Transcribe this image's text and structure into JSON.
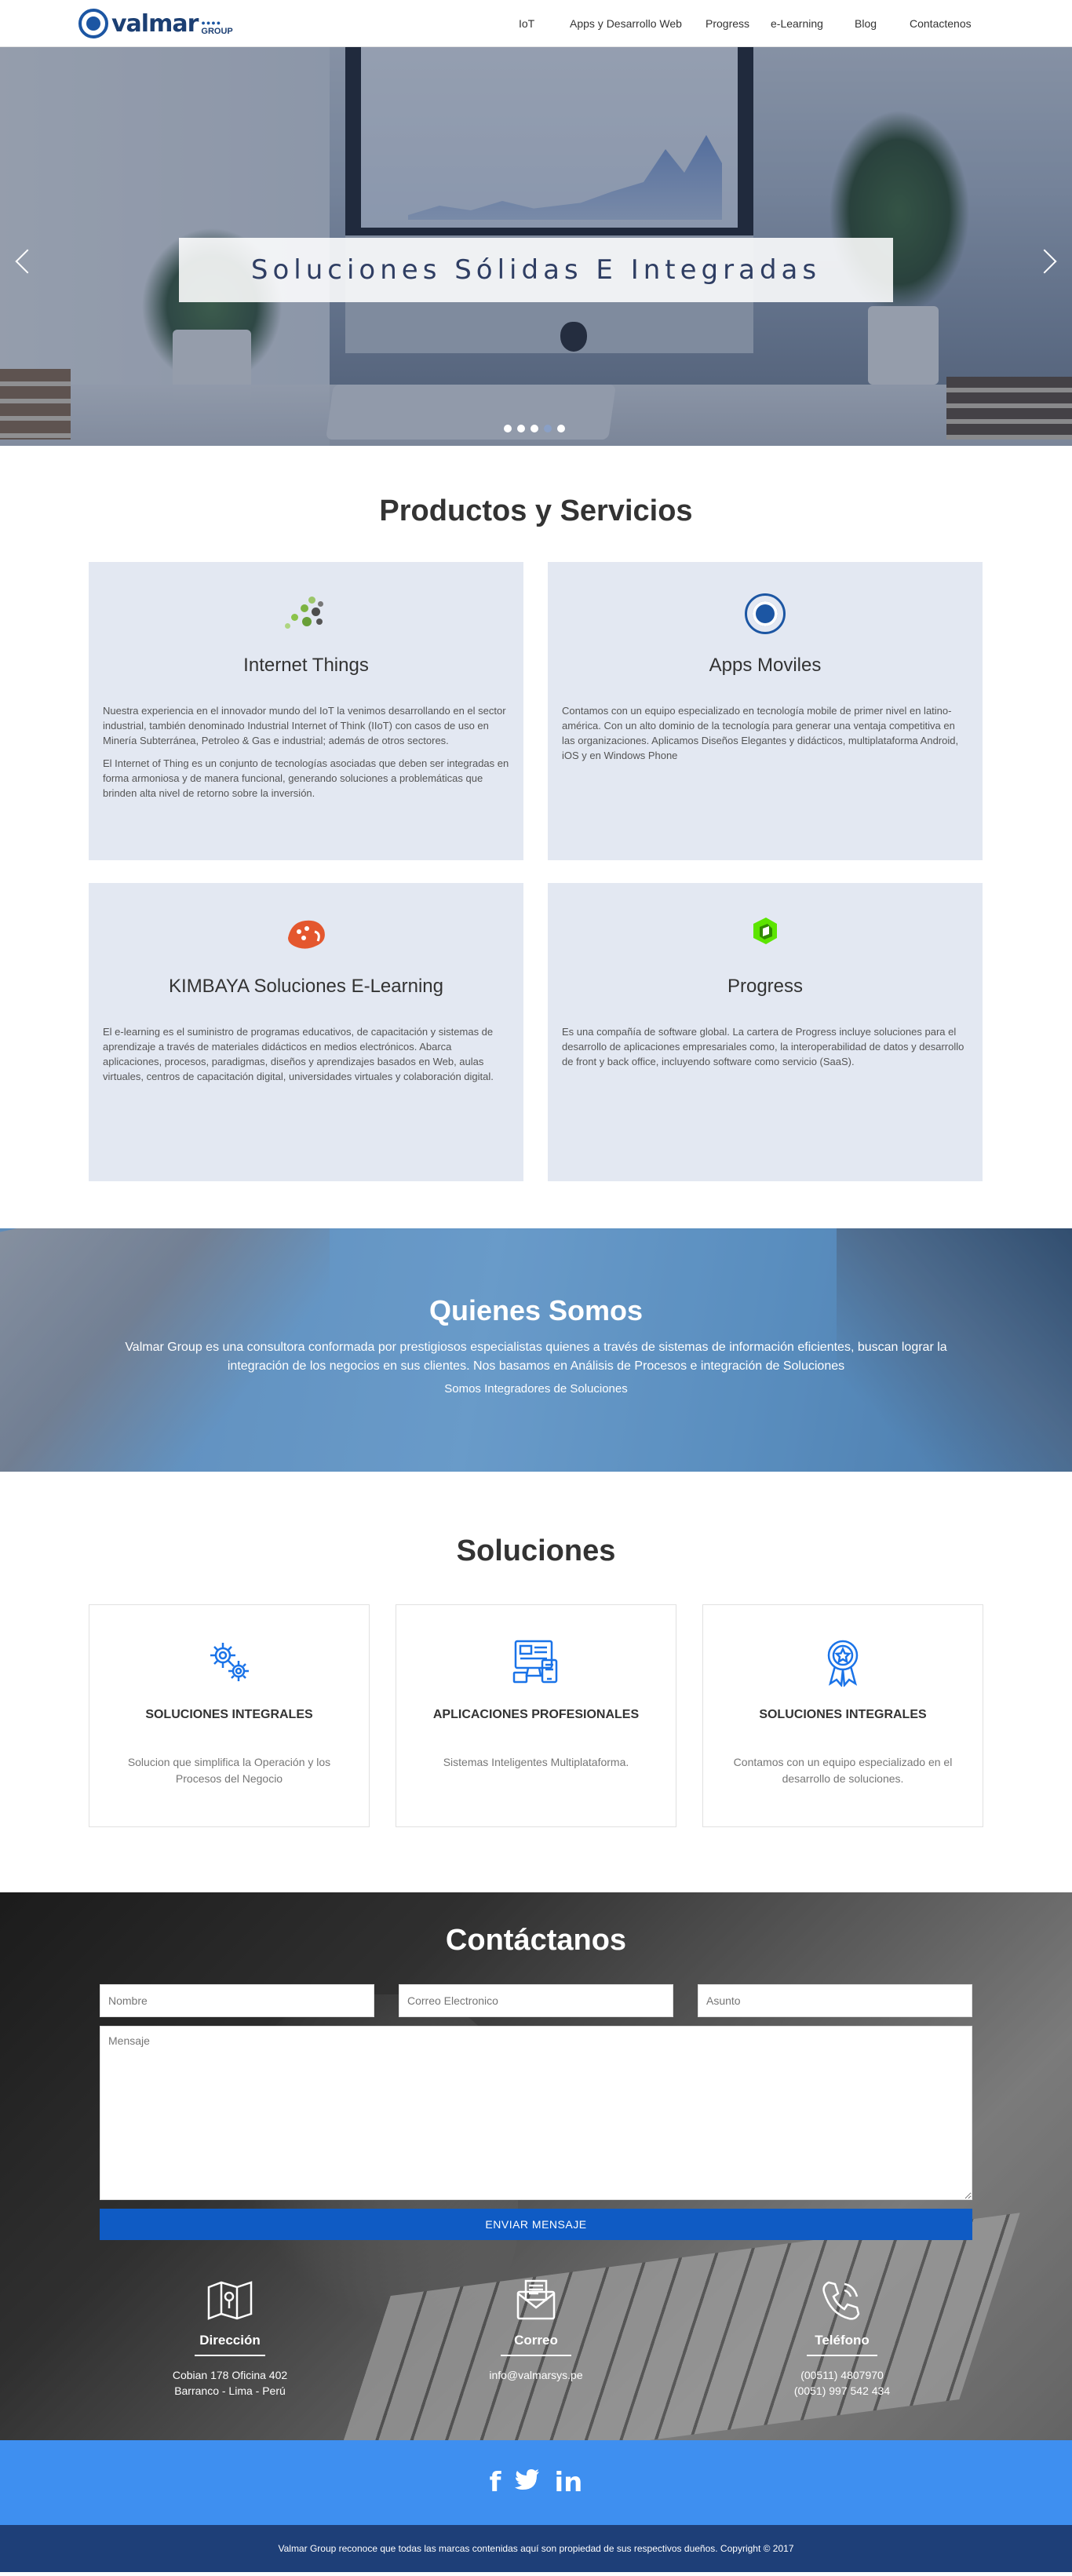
{
  "brand": {
    "name": "valmar",
    "group_text": "GROUP",
    "dots": "●●●●",
    "colors": {
      "primary": "#1c56a3",
      "dark": "#1c3f73",
      "button": "#0f5bc4",
      "social": "#3e8ff0",
      "footer": "#1e3f78",
      "card": "#e3e8f2"
    }
  },
  "nav": {
    "items": [
      {
        "label": "IoT"
      },
      {
        "label": "Apps y Desarrollo Web"
      },
      {
        "label": "Progress"
      },
      {
        "label": "e-Learning"
      },
      {
        "label": "Blog"
      },
      {
        "label": "Contactenos"
      }
    ]
  },
  "hero": {
    "caption": "Soluciones Sólidas E Integradas",
    "prev_icon": "chevron-left-icon",
    "next_icon": "chevron-right-icon",
    "slide_count": 5,
    "active_slide": 4
  },
  "productos": {
    "title": "Productos y Servicios",
    "cards": [
      {
        "icon": "iot-dots-icon",
        "title": "Internet Things",
        "paragraphs": [
          "Nuestra experiencia en el innovador mundo del IoT la venimos desarrollando en el sector industrial, también denominado Industrial Internet of Think (IIoT) con casos de uso en Minería Subterránea, Petroleo & Gas e industrial; además de otros sectores.",
          "El Internet of Thing es un conjunto de tecnologías asociadas que deben ser integradas en forma armoniosa y de manera funcional, generando soluciones a problemáticas que brinden alta nivel de retorno sobre la inversión."
        ]
      },
      {
        "icon": "circle-logo-icon",
        "title": "Apps Moviles",
        "paragraphs": [
          "Contamos con un equipo especializado en tecnología mobile de primer nivel en latino-américa. Con un alto dominio de la tecnología para generar una ventaja competitiva en las organizaciones. Aplicamos Diseños Elegantes y didácticos, multiplataforma Android, iOS y en Windows Phone"
        ]
      },
      {
        "icon": "kimbaya-logo-icon",
        "title": "KIMBAYA Soluciones E-Learning",
        "paragraphs": [
          "El e-learning es el suministro de programas educativos, de capacitación y sistemas de aprendizaje a través de materiales didácticos en medios electrónicos. Abarca aplicaciones, procesos, paradigmas, diseños y aprendizajes basados en Web, aulas virtuales, centros de capacitación digital, universidades virtuales y colaboración digital."
        ]
      },
      {
        "icon": "progress-logo-icon",
        "title": "Progress",
        "paragraphs": [
          "Es una compañía de software global. La cartera de Progress incluye soluciones para el desarrollo de aplicaciones empresariales como, la interoperabilidad de datos y desarrollo de front y back office, incluyendo software como servicio (SaaS)."
        ]
      }
    ]
  },
  "quienes": {
    "title": "Quienes Somos",
    "text": "Valmar Group es una consultora conformada por prestigiosos especialistas quienes a través de sistemas de información eficientes, buscan lograr la integración de los negocios en sus clientes. Nos basamos en Análisis de Procesos e integración de Soluciones",
    "subtitle": "Somos Integradores de Soluciones"
  },
  "soluciones": {
    "title": "Soluciones",
    "cards": [
      {
        "icon": "gears-icon",
        "title": "SOLUCIONES INTEGRALES",
        "text": "Solucion que simplifica la Operación y los Procesos del Negocio"
      },
      {
        "icon": "devices-icon",
        "title": "APLICACIONES PROFESIONALES",
        "text": "Sistemas Inteligentes Multiplataforma."
      },
      {
        "icon": "award-icon",
        "title": "SOLUCIONES INTEGRALES",
        "text": "Contamos con un equipo especializado en el desarrollo de soluciones."
      }
    ]
  },
  "contacto": {
    "title": "Contáctanos",
    "fields": {
      "nombre_placeholder": "Nombre",
      "email_placeholder": "Correo Electronico",
      "asunto_placeholder": "Asunto",
      "mensaje_placeholder": "Mensaje"
    },
    "button": "ENVIAR MENSAJE",
    "info": [
      {
        "icon": "map-icon",
        "title": "Dirección",
        "lines": [
          "Cobian 178 Oficina 402",
          "Barranco - Lima - Perú"
        ]
      },
      {
        "icon": "envelope-icon",
        "title": "Correo",
        "lines": [
          "info@valmarsys.pe"
        ]
      },
      {
        "icon": "phone-icon",
        "title": "Teléfono",
        "lines": [
          "(00511) 4807970",
          "(0051) 997 542 434"
        ]
      }
    ]
  },
  "social": {
    "items": [
      {
        "icon": "facebook-icon",
        "glyph": "f"
      },
      {
        "icon": "twitter-icon",
        "glyph": "🐦"
      },
      {
        "icon": "linkedin-icon",
        "glyph": "in"
      }
    ]
  },
  "footer": {
    "copyright": "Valmar Group reconoce que todas las marcas contenidas aquí son propiedad de sus respectivos dueños. Copyright © 2017"
  }
}
